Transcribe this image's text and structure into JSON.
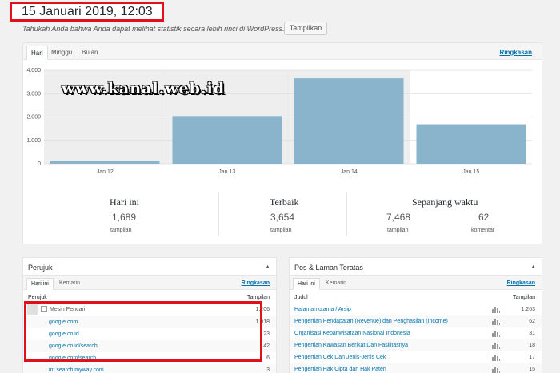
{
  "header": {
    "date": "15 Januari 2019, 12:03",
    "hint": "Tahukah Anda bahwa Anda dapat melihat statistik secara lebih rinci di WordPress.com?",
    "show_button": "Tampilkan"
  },
  "watermark": "www.kanal.web.id",
  "tabs": {
    "day": "Hari",
    "week": "Minggu",
    "month": "Bulan",
    "summary_link": "Ringkasan"
  },
  "chart_data": {
    "type": "bar",
    "categories": [
      "Jan 12",
      "Jan 13",
      "Jan 14",
      "Jan 15"
    ],
    "values": [
      120,
      2040,
      3654,
      1689
    ],
    "yticks": [
      "0",
      "1.000",
      "2.000",
      "3.000",
      "4.000"
    ],
    "ylim": [
      0,
      4000
    ],
    "grid": true,
    "bar_color": "#8ab4cb",
    "highlight_background": "#eeeeee"
  },
  "summary": {
    "today": {
      "title": "Hari ini",
      "value": "1,689",
      "label": "tampilan"
    },
    "best": {
      "title": "Terbaik",
      "value": "3,654",
      "label": "tampilan"
    },
    "all_time": {
      "title": "Sepanjang waktu",
      "views": "7,468",
      "views_label": "tampilan",
      "comments": "62",
      "comments_label": "komentar"
    }
  },
  "referrers": {
    "title": "Perujuk",
    "tab_today": "Hari ini",
    "tab_yesterday": "Kemarin",
    "summary_link": "Ringkasan",
    "col_label": "Perujuk",
    "col_value": "Tampilan",
    "group": {
      "label": "Mesin Pencari",
      "value": "1.206"
    },
    "rows": [
      {
        "label": "google.com",
        "value": "1.018"
      },
      {
        "label": "google.co.id",
        "value": "123"
      },
      {
        "label": "google.co.id/search",
        "value": "42"
      },
      {
        "label": "google.com/search",
        "value": "6"
      },
      {
        "label": "int.search.myway.com",
        "value": "3"
      }
    ]
  },
  "top_posts": {
    "title": "Pos & Laman Teratas",
    "tab_today": "Hari ini",
    "tab_yesterday": "Kemarin",
    "summary_link": "Ringkasan",
    "col_label": "Judul",
    "col_value": "Tampilan",
    "rows": [
      {
        "label": "Halaman utama / Arsip",
        "value": "1.263"
      },
      {
        "label": "Pengertian Pendapatan (Revenue) dan Penghasilan (Income)",
        "value": "62"
      },
      {
        "label": "Organisasi Kepariwisataan Nasional Indonesia",
        "value": "31"
      },
      {
        "label": "Pengertian Kawasan Berikat Dan Fasilitasnya",
        "value": "18"
      },
      {
        "label": "Pengertian Cek Dan Jenis-Jenis Cek",
        "value": "17"
      },
      {
        "label": "Pengertian Hak Cipta dan Hak Paten",
        "value": "15"
      }
    ]
  }
}
